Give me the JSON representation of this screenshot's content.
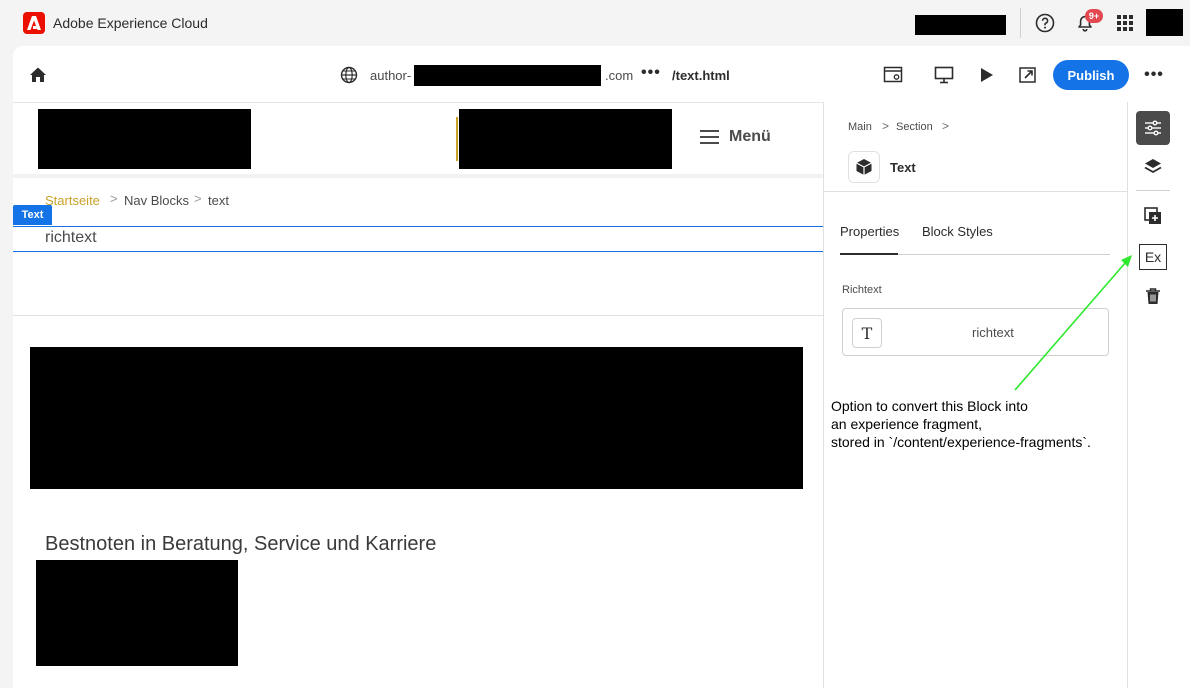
{
  "shell": {
    "title": "Adobe Experience Cloud",
    "notification_count": "9+"
  },
  "toolbar": {
    "url_prefix": "author-",
    "url_suffix": ".com",
    "url_more": "•••",
    "url_path": "/text.html",
    "publish_label": "Publish",
    "more_label": "•••"
  },
  "canvas": {
    "menu_label": "Menü",
    "breadcrumb": [
      "Startseite",
      "Nav Blocks",
      "text"
    ],
    "breadcrumb_separator": ">",
    "selected_block_badge": "Text",
    "richtext": "richtext",
    "heading": "Bestnoten in Beratung, Service und Karriere"
  },
  "panel": {
    "breadcrumb": [
      "Main",
      "Section"
    ],
    "breadcrumb_separator": ">",
    "block_name": "Text",
    "tabs": [
      "Properties",
      "Block Styles"
    ],
    "active_tab": "Properties",
    "field_label": "Richtext",
    "field_icon": "T",
    "field_value": "richtext"
  },
  "rail": {
    "ex_label": "Ex"
  },
  "annotation": {
    "lines": [
      "Option to convert this Block into",
      "an experience fragment,",
      "stored in `/content/experience-fragments`."
    ],
    "arrow_color": "#2ee82e"
  },
  "colors": {
    "accent": "#1473e6",
    "adobe_red": "#eb1000",
    "breadcrumb_first": "#c9a227",
    "badge": "#e34850"
  }
}
